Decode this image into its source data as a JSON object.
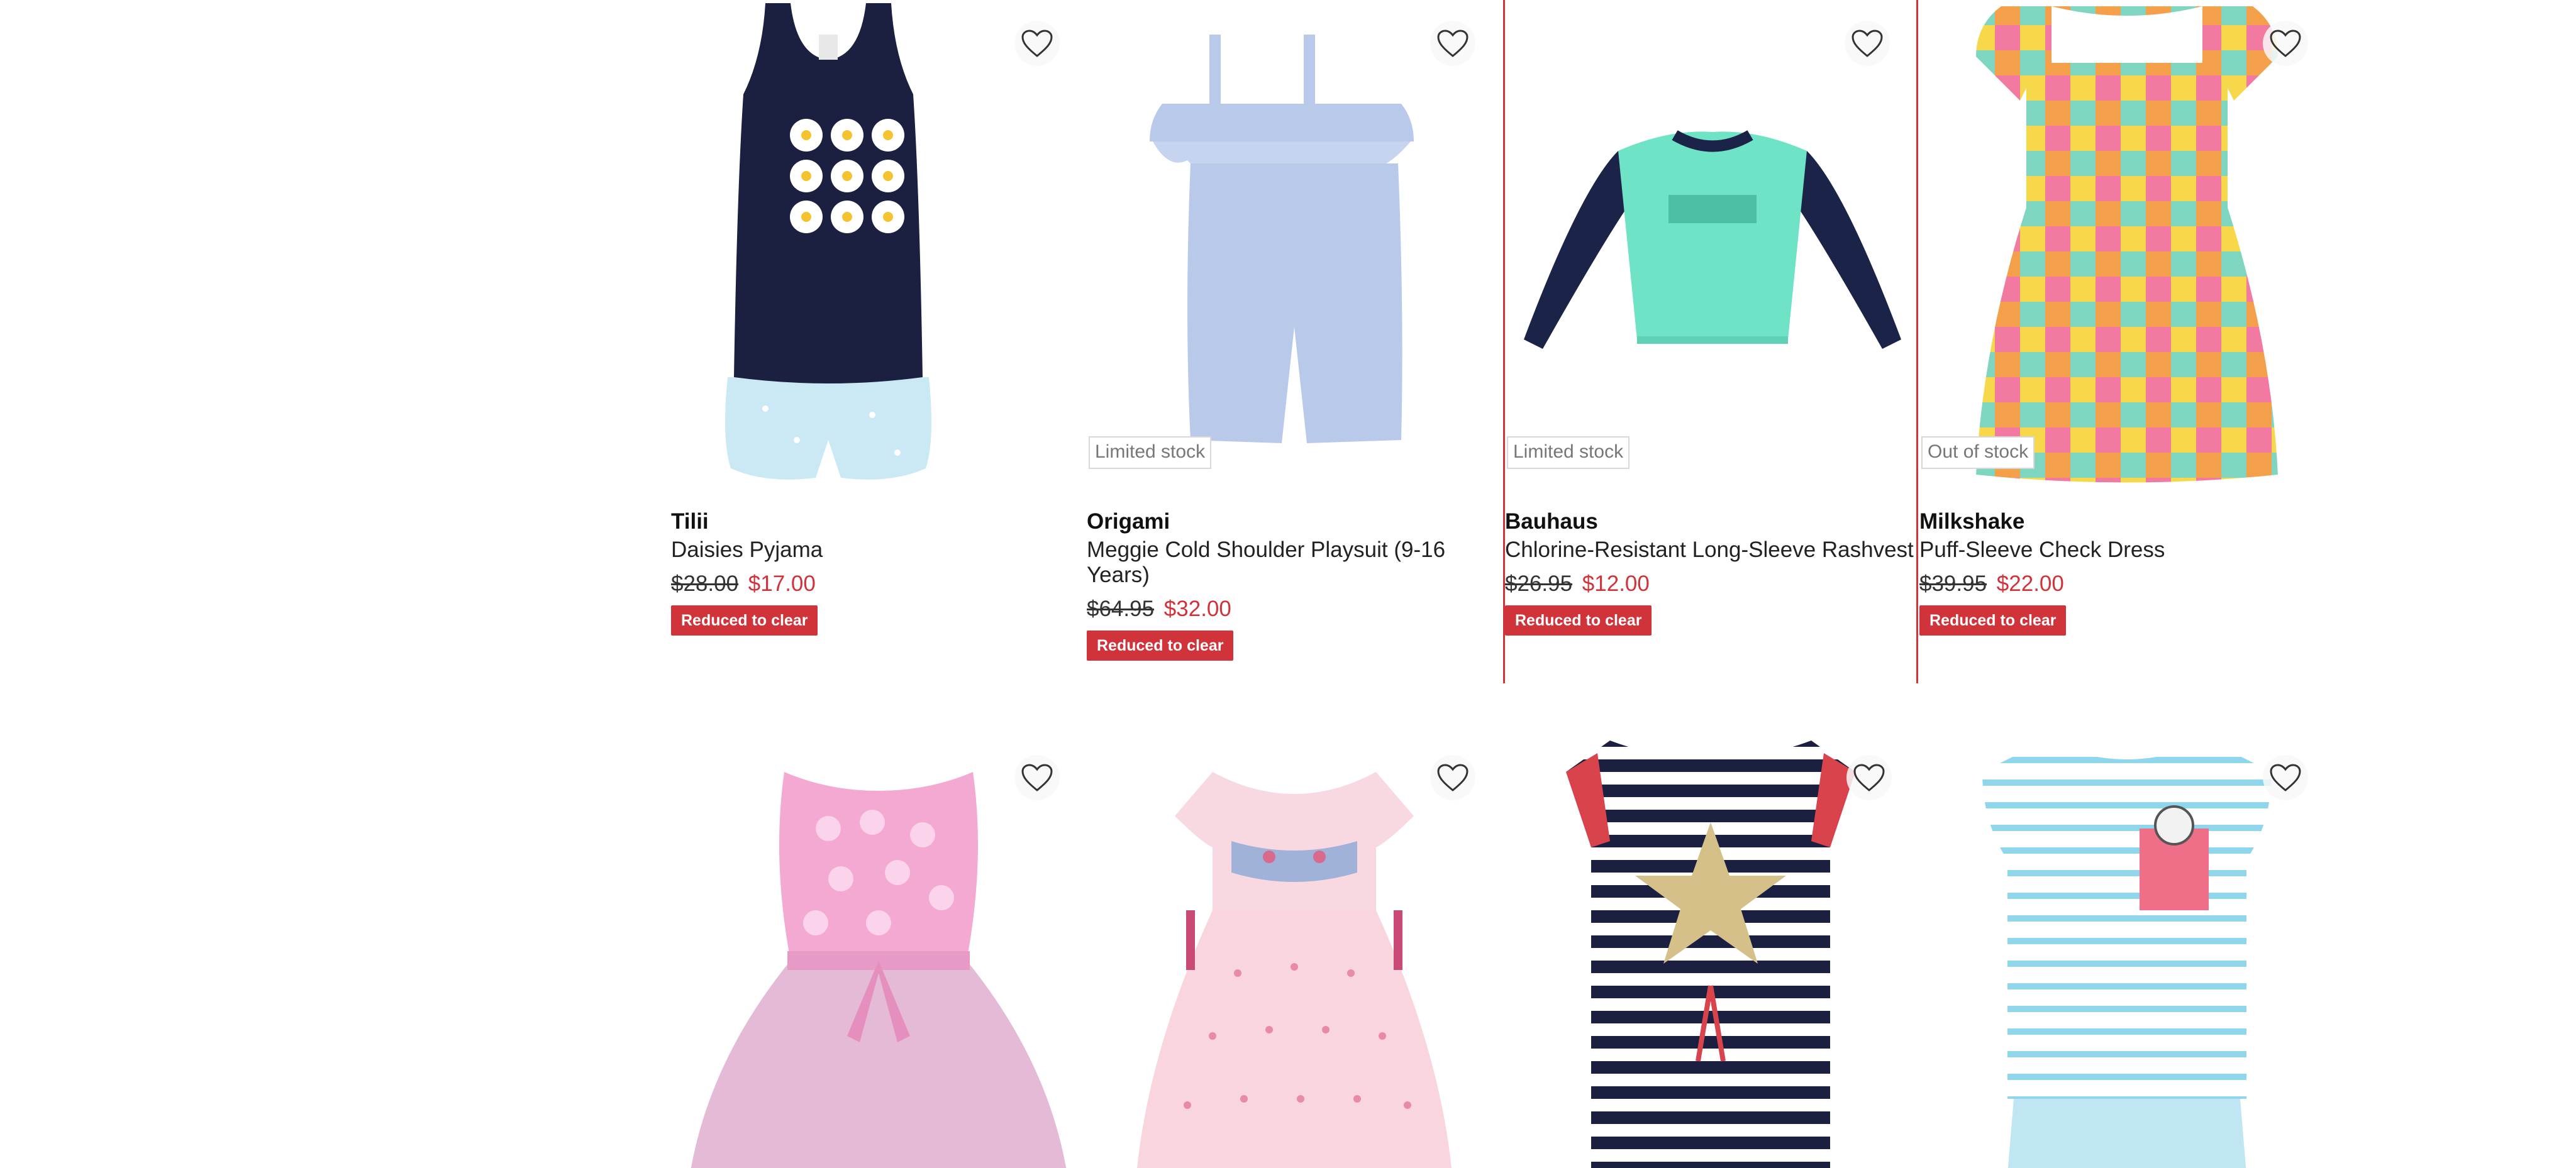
{
  "products": [
    {
      "brand": "Tilii",
      "name": "Daisies Pyjama",
      "old_price": "$28.00",
      "new_price": "$17.00",
      "badge": "Reduced to clear",
      "stock_status": "",
      "image": "navy-daisy-tank-pyjama"
    },
    {
      "brand": "Origami",
      "name": "Meggie Cold Shoulder Playsuit (9-16 Years)",
      "old_price": "$64.95",
      "new_price": "$32.00",
      "badge": "Reduced to clear",
      "stock_status": "Limited stock",
      "image": "blue-cold-shoulder-playsuit"
    },
    {
      "brand": "Bauhaus",
      "name": "Chlorine-Resistant Long-Sleeve Rashvest",
      "old_price": "$26.95",
      "new_price": "$12.00",
      "badge": "Reduced to clear",
      "stock_status": "Limited stock",
      "image": "mint-navy-rashvest"
    },
    {
      "brand": "Milkshake",
      "name": "Puff-Sleeve Check Dress",
      "old_price": "$39.95",
      "new_price": "$22.00",
      "badge": "Reduced to clear",
      "stock_status": "Out of stock",
      "image": "rainbow-check-dress"
    },
    {
      "image": "pink-flower-tulle-dress"
    },
    {
      "image": "pink-embroidered-frill-dress"
    },
    {
      "image": "navy-stripe-sequin-star-dress"
    },
    {
      "image": "blue-stripe-dog-pocket-tee"
    }
  ],
  "colors": {
    "sale_red": "#d0333a",
    "text": "#222222",
    "stock_tag_border": "#d8d8d8"
  }
}
